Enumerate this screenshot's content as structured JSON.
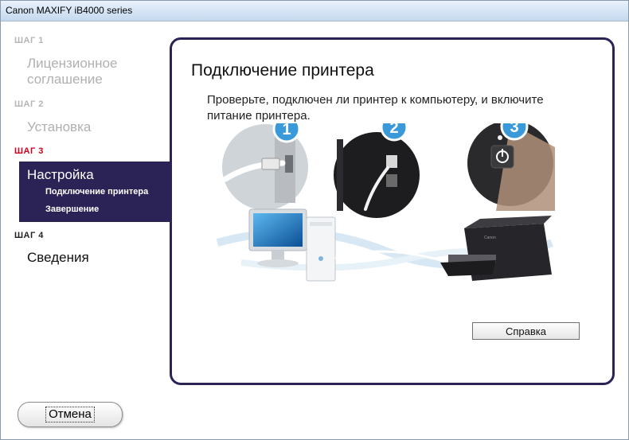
{
  "window": {
    "title": "Canon MAXIFY iB4000 series"
  },
  "sidebar": {
    "steps": [
      {
        "label": "ШАГ 1",
        "title": "Лицензионное соглашение"
      },
      {
        "label": "ШАГ 2",
        "title": "Установка"
      },
      {
        "label": "ШАГ 3",
        "title": "Настройка",
        "substeps": [
          "Подключение принтера",
          "Завершение"
        ]
      },
      {
        "label": "ШАГ 4",
        "title": "Сведения"
      }
    ]
  },
  "main": {
    "title": "Подключение принтера",
    "description": "Проверьте, подключен ли принтер к компьютеру, и включите питание принтера.",
    "callouts": [
      "1",
      "2",
      "3"
    ],
    "help_button": "Справка"
  },
  "footer": {
    "cancel_button": "Отмена"
  },
  "colors": {
    "accent": "#2b2356",
    "active_step": "#d0021b",
    "callout": "#3a9ad9"
  },
  "icons": [
    "usb-cable-icon",
    "power-button-icon",
    "computer-icon",
    "printer-icon"
  ]
}
